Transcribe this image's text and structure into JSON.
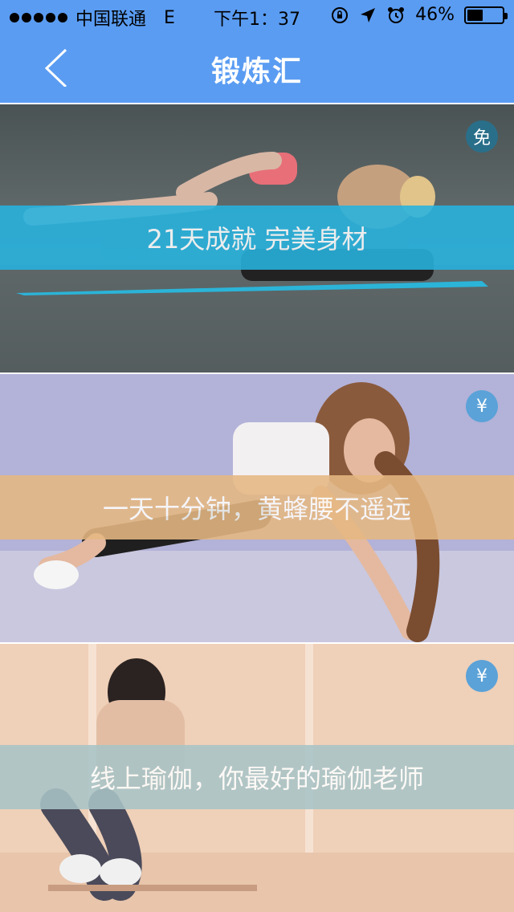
{
  "status_bar": {
    "carrier": "中国联通",
    "network": "E",
    "time": "下午1：37",
    "battery": "46%",
    "battery_level": 0.46
  },
  "header": {
    "title": "锻炼汇",
    "back_icon": "chevron-left-icon"
  },
  "courses": [
    {
      "title": "21天成就 完美身材",
      "badge": "免",
      "banner_color": "#27b3df",
      "badge_color": "#2a6f8a"
    },
    {
      "title": "一天十分钟，黄蜂腰不遥远",
      "badge": "¥",
      "banner_color": "#e6b882",
      "badge_color": "#5aa2d8"
    },
    {
      "title": "线上瑜伽，你最好的瑜伽老师",
      "badge": "¥",
      "banner_color": "#a9c4c7",
      "badge_color": "#5aa2d8"
    }
  ],
  "colors": {
    "accent": "#5a9cf2"
  }
}
